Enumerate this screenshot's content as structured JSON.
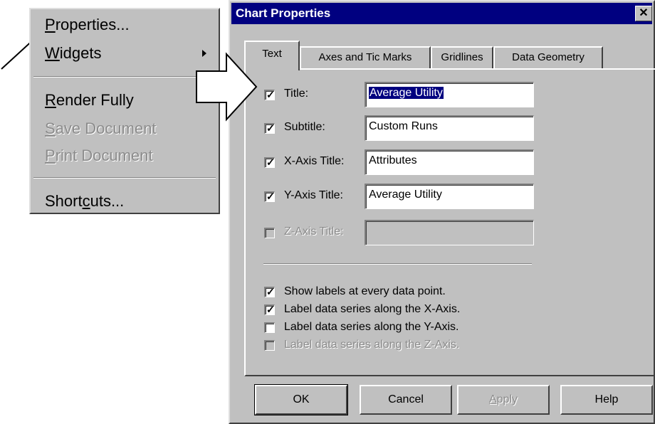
{
  "menu": {
    "items": [
      {
        "pre": "",
        "mnemonic": "P",
        "post": "roperties...",
        "enabled": true
      },
      {
        "pre": "",
        "mnemonic": "W",
        "post": "idgets",
        "enabled": true,
        "submenu": true
      },
      {
        "pre": "",
        "mnemonic": "R",
        "post": "ender Fully",
        "enabled": true
      },
      {
        "pre": "",
        "mnemonic": "S",
        "post": "ave Document",
        "enabled": false
      },
      {
        "pre": "",
        "mnemonic": "P",
        "post": "rint Document",
        "enabled": false
      },
      {
        "pre": "Short",
        "mnemonic": "c",
        "post": "uts...",
        "enabled": true
      }
    ]
  },
  "dialog": {
    "title": "Chart Properties",
    "close": "✕",
    "tabs": [
      "Text",
      "Axes and Tic Marks",
      "Gridlines",
      "Data Geometry"
    ],
    "fields": [
      {
        "label": "Title:",
        "value": "Average Utility",
        "checked": true,
        "enabled": true
      },
      {
        "label": "Subtitle:",
        "value": "Custom Runs",
        "checked": true,
        "enabled": true
      },
      {
        "label": "X-Axis Title:",
        "value": "Attributes",
        "checked": true,
        "enabled": true
      },
      {
        "label": "Y-Axis Title:",
        "value": "Average Utility",
        "checked": true,
        "enabled": true
      },
      {
        "label": "Z-Axis Title:",
        "value": "",
        "checked": false,
        "enabled": false
      }
    ],
    "options": [
      {
        "label": "Show labels at every data point.",
        "checked": true,
        "enabled": true
      },
      {
        "label": "Label data series along the X-Axis.",
        "checked": true,
        "enabled": true
      },
      {
        "label": "Label data series along the Y-Axis.",
        "checked": false,
        "enabled": true
      },
      {
        "label": "Label data series along the Z-Axis.",
        "checked": false,
        "enabled": false
      }
    ],
    "buttons": {
      "ok": "OK",
      "cancel": "Cancel",
      "apply_pre": "",
      "apply_mnemonic": "A",
      "apply_post": "pply",
      "help": "Help"
    },
    "check_glyph": "✓"
  }
}
